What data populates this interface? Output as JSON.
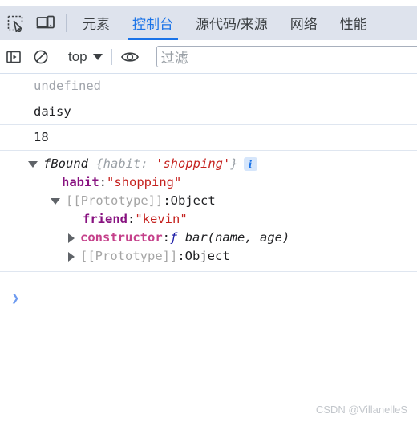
{
  "tabbar": {
    "inspect_icon": "inspect-element-icon",
    "device_icon": "device-toolbar-icon",
    "tabs": [
      {
        "label": "元素",
        "active": false
      },
      {
        "label": "控制台",
        "active": true
      },
      {
        "label": "源代码/来源",
        "active": false
      },
      {
        "label": "网络",
        "active": false
      },
      {
        "label": "性能",
        "active": false
      }
    ],
    "active_color": "#1a73e8",
    "background": "#dee3ed"
  },
  "console_toolbar": {
    "sidebar_icon": "sidebar-toggle-icon",
    "clear_icon": "clear-console-icon",
    "context_label": "top",
    "caret_icon": "chevron-down-icon",
    "eye_icon": "eye-icon",
    "filter_placeholder": "过滤"
  },
  "messages": [
    {
      "kind": "undefined",
      "text": "undefined"
    },
    {
      "kind": "plain",
      "text": "daisy"
    },
    {
      "kind": "plain",
      "text": "18"
    }
  ],
  "object_output": {
    "header": {
      "triangle": "triangle-down-icon",
      "ctor_name": "fBound",
      "preview_open": "{habit:",
      "preview_value": "'shopping'",
      "preview_close": "}",
      "info_badge": "i"
    },
    "rows": [
      {
        "triangle": "none",
        "indent": 77,
        "key": "habit",
        "key_style": "key",
        "sep": ": ",
        "value": "\"shopping\"",
        "value_style": "string"
      },
      {
        "triangle": "triangle-down-icon",
        "indent": 63,
        "key": "[[Prototype]]",
        "key_style": "protokey",
        "sep": ": ",
        "value": "Object",
        "value_style": "dark"
      },
      {
        "triangle": "none",
        "indent": 103,
        "key": "friend",
        "key_style": "key",
        "sep": ": ",
        "value": "\"kevin\"",
        "value_style": "string"
      },
      {
        "triangle": "triangle-right-icon",
        "indent": 85,
        "key": "constructor",
        "key_style": "keypink",
        "sep": ": ",
        "value_fn": "ƒ",
        "value": "bar(name, age)",
        "value_style": "function"
      },
      {
        "triangle": "triangle-right-icon",
        "indent": 85,
        "key": "[[Prototype]]",
        "key_style": "protokey",
        "sep": ": ",
        "value": "Object",
        "value_style": "dark"
      }
    ]
  },
  "prompt": {
    "chevron": "❯",
    "value": ""
  },
  "watermark": {
    "text": "CSDN @VillanelleS"
  }
}
